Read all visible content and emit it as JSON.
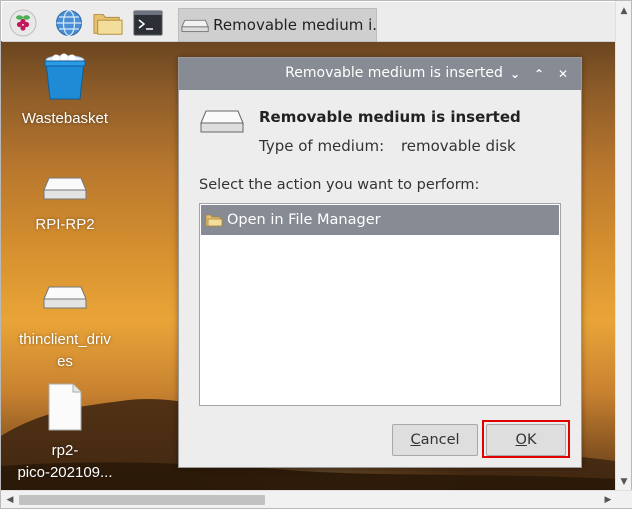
{
  "taskbar": {
    "icons": [
      "raspberry-menu-icon",
      "web-browser-icon",
      "file-manager-icon",
      "terminal-icon"
    ],
    "window_button_label": "Removable medium i..."
  },
  "desktop": {
    "icons": [
      {
        "name": "wastebasket",
        "label": "Wastebasket"
      },
      {
        "name": "rpi-rp2",
        "label": "RPI-RP2"
      },
      {
        "name": "thinclient",
        "label_line1": "thinclient_driv",
        "label_line2": "es"
      },
      {
        "name": "rp2-file",
        "label_line1": "rp2-",
        "label_line2": "pico-202109..."
      }
    ]
  },
  "dialog": {
    "title": "Removable medium is inserted",
    "heading": "Removable medium is inserted",
    "type_label": "Type of medium:",
    "type_value": "removable disk",
    "prompt": "Select the action you want to perform:",
    "actions": [
      {
        "label": "Open in File Manager",
        "selected": true
      }
    ],
    "cancel_label": "Cancel",
    "ok_label": "OK"
  },
  "colors": {
    "dialog_titlebar": "#878c94",
    "selection": "#878c94",
    "highlight_box": "#e00000"
  }
}
